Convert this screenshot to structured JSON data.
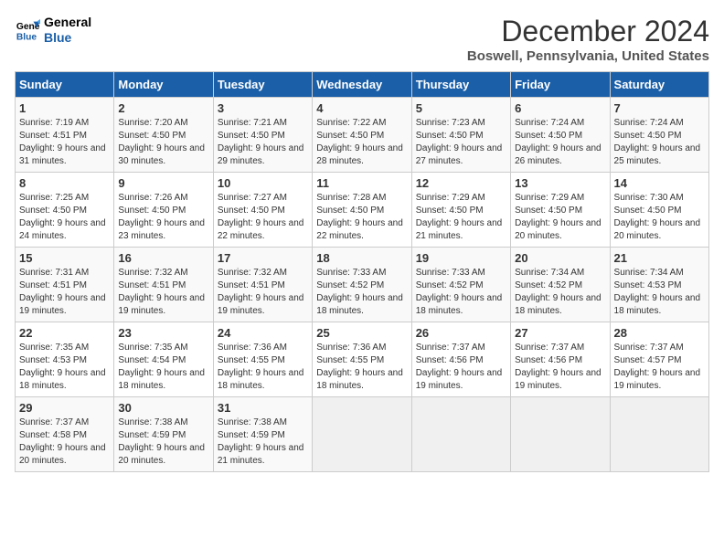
{
  "header": {
    "logo_line1": "General",
    "logo_line2": "Blue",
    "month": "December 2024",
    "location": "Boswell, Pennsylvania, United States"
  },
  "days_of_week": [
    "Sunday",
    "Monday",
    "Tuesday",
    "Wednesday",
    "Thursday",
    "Friday",
    "Saturday"
  ],
  "weeks": [
    [
      {
        "day": "1",
        "sunrise": "7:19 AM",
        "sunset": "4:51 PM",
        "daylight": "9 hours and 31 minutes."
      },
      {
        "day": "2",
        "sunrise": "7:20 AM",
        "sunset": "4:50 PM",
        "daylight": "9 hours and 30 minutes."
      },
      {
        "day": "3",
        "sunrise": "7:21 AM",
        "sunset": "4:50 PM",
        "daylight": "9 hours and 29 minutes."
      },
      {
        "day": "4",
        "sunrise": "7:22 AM",
        "sunset": "4:50 PM",
        "daylight": "9 hours and 28 minutes."
      },
      {
        "day": "5",
        "sunrise": "7:23 AM",
        "sunset": "4:50 PM",
        "daylight": "9 hours and 27 minutes."
      },
      {
        "day": "6",
        "sunrise": "7:24 AM",
        "sunset": "4:50 PM",
        "daylight": "9 hours and 26 minutes."
      },
      {
        "day": "7",
        "sunrise": "7:24 AM",
        "sunset": "4:50 PM",
        "daylight": "9 hours and 25 minutes."
      }
    ],
    [
      {
        "day": "8",
        "sunrise": "7:25 AM",
        "sunset": "4:50 PM",
        "daylight": "9 hours and 24 minutes."
      },
      {
        "day": "9",
        "sunrise": "7:26 AM",
        "sunset": "4:50 PM",
        "daylight": "9 hours and 23 minutes."
      },
      {
        "day": "10",
        "sunrise": "7:27 AM",
        "sunset": "4:50 PM",
        "daylight": "9 hours and 22 minutes."
      },
      {
        "day": "11",
        "sunrise": "7:28 AM",
        "sunset": "4:50 PM",
        "daylight": "9 hours and 22 minutes."
      },
      {
        "day": "12",
        "sunrise": "7:29 AM",
        "sunset": "4:50 PM",
        "daylight": "9 hours and 21 minutes."
      },
      {
        "day": "13",
        "sunrise": "7:29 AM",
        "sunset": "4:50 PM",
        "daylight": "9 hours and 20 minutes."
      },
      {
        "day": "14",
        "sunrise": "7:30 AM",
        "sunset": "4:50 PM",
        "daylight": "9 hours and 20 minutes."
      }
    ],
    [
      {
        "day": "15",
        "sunrise": "7:31 AM",
        "sunset": "4:51 PM",
        "daylight": "9 hours and 19 minutes."
      },
      {
        "day": "16",
        "sunrise": "7:32 AM",
        "sunset": "4:51 PM",
        "daylight": "9 hours and 19 minutes."
      },
      {
        "day": "17",
        "sunrise": "7:32 AM",
        "sunset": "4:51 PM",
        "daylight": "9 hours and 19 minutes."
      },
      {
        "day": "18",
        "sunrise": "7:33 AM",
        "sunset": "4:52 PM",
        "daylight": "9 hours and 18 minutes."
      },
      {
        "day": "19",
        "sunrise": "7:33 AM",
        "sunset": "4:52 PM",
        "daylight": "9 hours and 18 minutes."
      },
      {
        "day": "20",
        "sunrise": "7:34 AM",
        "sunset": "4:52 PM",
        "daylight": "9 hours and 18 minutes."
      },
      {
        "day": "21",
        "sunrise": "7:34 AM",
        "sunset": "4:53 PM",
        "daylight": "9 hours and 18 minutes."
      }
    ],
    [
      {
        "day": "22",
        "sunrise": "7:35 AM",
        "sunset": "4:53 PM",
        "daylight": "9 hours and 18 minutes."
      },
      {
        "day": "23",
        "sunrise": "7:35 AM",
        "sunset": "4:54 PM",
        "daylight": "9 hours and 18 minutes."
      },
      {
        "day": "24",
        "sunrise": "7:36 AM",
        "sunset": "4:55 PM",
        "daylight": "9 hours and 18 minutes."
      },
      {
        "day": "25",
        "sunrise": "7:36 AM",
        "sunset": "4:55 PM",
        "daylight": "9 hours and 18 minutes."
      },
      {
        "day": "26",
        "sunrise": "7:37 AM",
        "sunset": "4:56 PM",
        "daylight": "9 hours and 19 minutes."
      },
      {
        "day": "27",
        "sunrise": "7:37 AM",
        "sunset": "4:56 PM",
        "daylight": "9 hours and 19 minutes."
      },
      {
        "day": "28",
        "sunrise": "7:37 AM",
        "sunset": "4:57 PM",
        "daylight": "9 hours and 19 minutes."
      }
    ],
    [
      {
        "day": "29",
        "sunrise": "7:37 AM",
        "sunset": "4:58 PM",
        "daylight": "9 hours and 20 minutes."
      },
      {
        "day": "30",
        "sunrise": "7:38 AM",
        "sunset": "4:59 PM",
        "daylight": "9 hours and 20 minutes."
      },
      {
        "day": "31",
        "sunrise": "7:38 AM",
        "sunset": "4:59 PM",
        "daylight": "9 hours and 21 minutes."
      },
      null,
      null,
      null,
      null
    ]
  ],
  "labels": {
    "sunrise": "Sunrise:",
    "sunset": "Sunset:",
    "daylight": "Daylight:"
  }
}
